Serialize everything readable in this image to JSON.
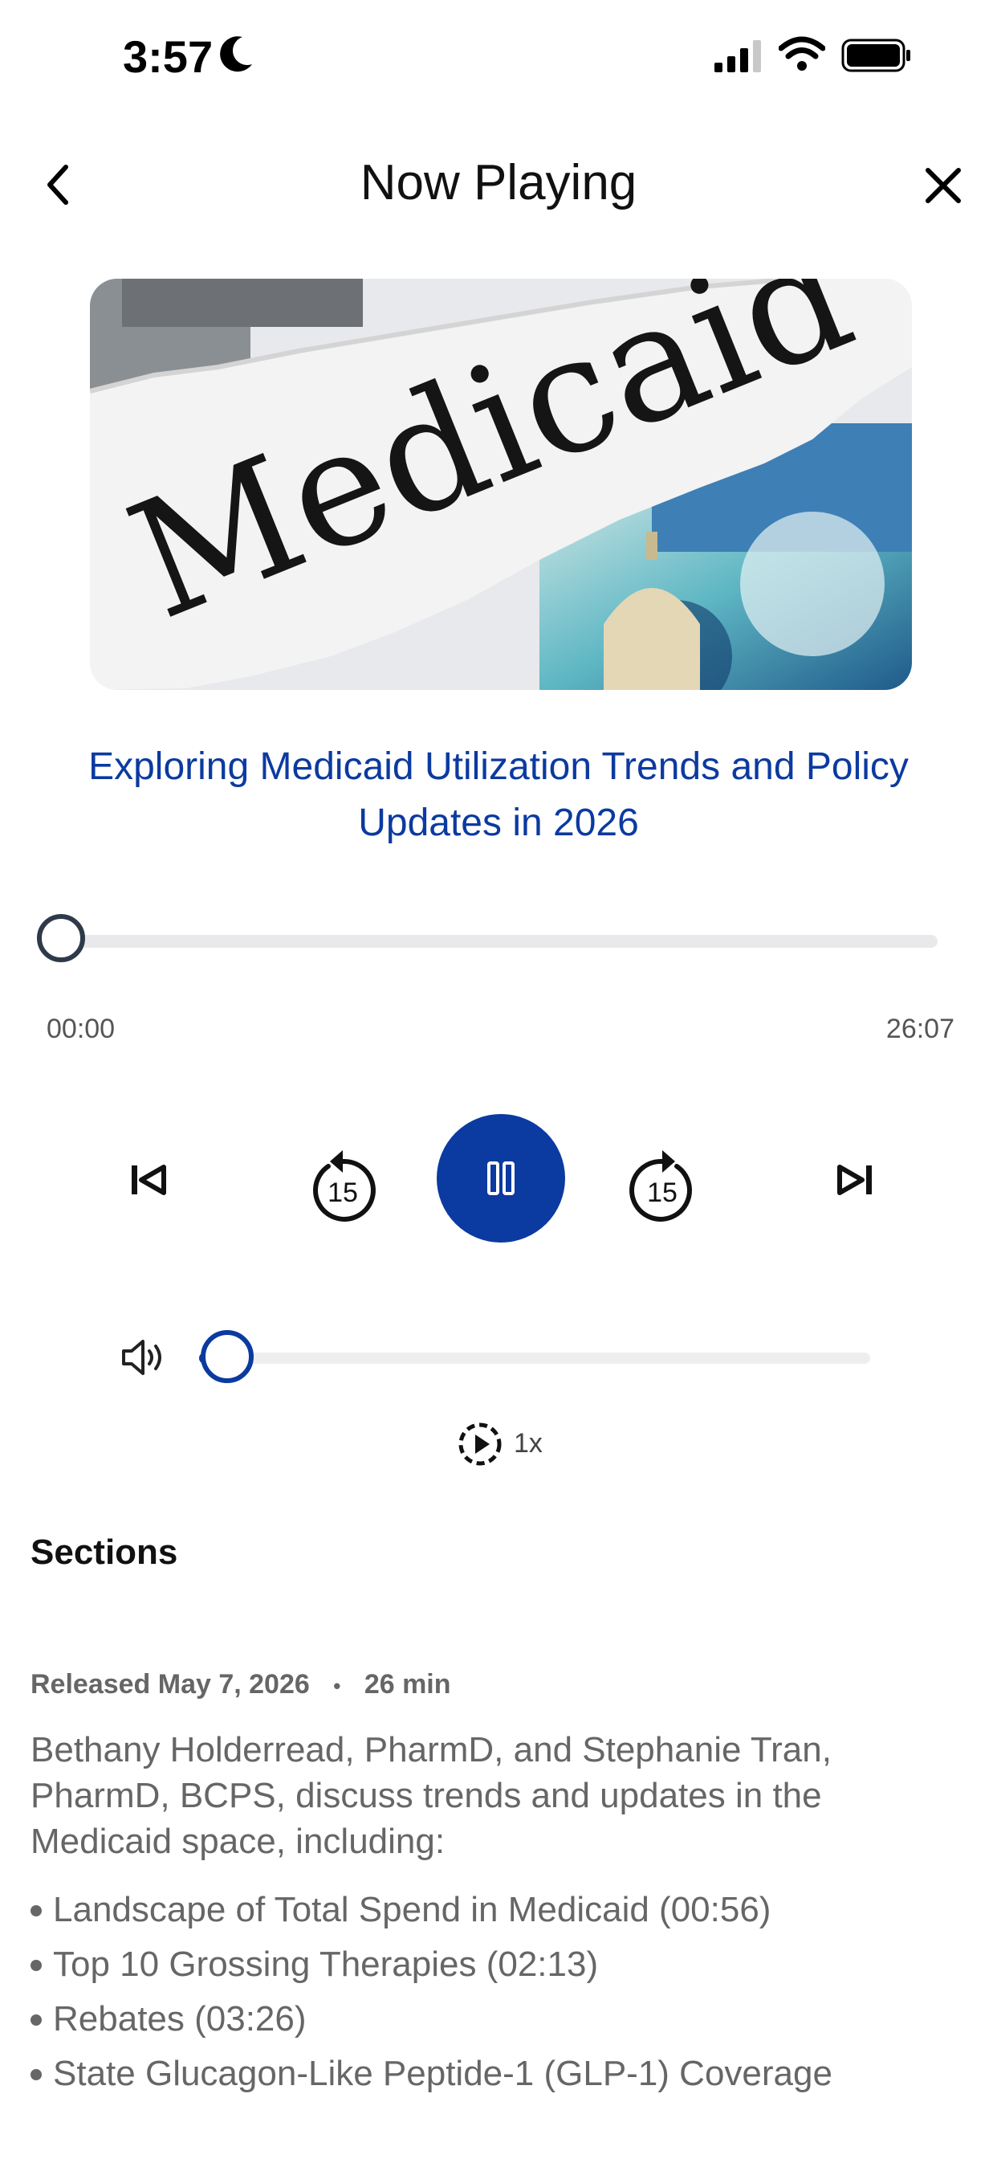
{
  "status_bar": {
    "time": "3:57"
  },
  "header": {
    "title": "Now Playing"
  },
  "artwork": {
    "word": "Medicaid"
  },
  "episode": {
    "title": "Exploring Medicaid Utilization Trends and Policy Updates in 2026"
  },
  "player": {
    "elapsed": "00:00",
    "total": "26:07",
    "progress_fraction": 0,
    "volume_fraction": 0.03,
    "rewind_seconds": "15",
    "forward_seconds": "15",
    "speed": "1x"
  },
  "sections": {
    "heading": "Sections",
    "released": "Released May 7, 2026",
    "separator": "•",
    "duration": "26 min",
    "description": "Bethany Holderread, PharmD, and Stephanie Tran, PharmD, BCPS, discuss trends and updates in the Medicaid space, including:",
    "items": [
      "Landscape of Total Spend in Medicaid (00:56)",
      "Top 10 Grossing Therapies (02:13)",
      "Rebates (03:26)",
      "State Glucagon-Like Peptide-1 (GLP-1) Coverage"
    ]
  },
  "colors": {
    "accent": "#0b3aa0",
    "muted_text": "#666666"
  }
}
